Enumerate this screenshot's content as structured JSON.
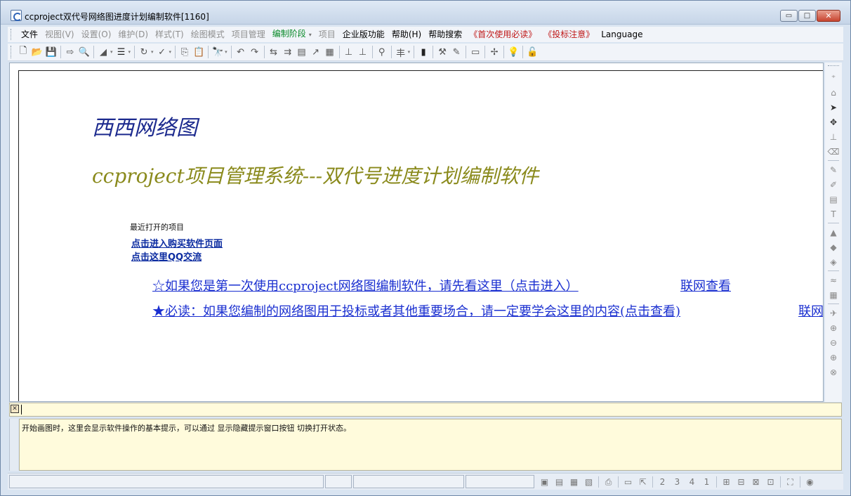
{
  "window": {
    "title": "ccproject双代号网络图进度计划编制软件[1160]",
    "min_label": "▭",
    "max_label": "□",
    "close_label": "✕"
  },
  "menu": {
    "items": [
      {
        "label": "文件",
        "state": "normal"
      },
      {
        "label": "视图(V)",
        "state": "disabled"
      },
      {
        "label": "设置(O)",
        "state": "disabled"
      },
      {
        "label": "维护(D)",
        "state": "disabled"
      },
      {
        "label": "样式(T)",
        "state": "disabled"
      },
      {
        "label": "绘图模式",
        "state": "disabled"
      },
      {
        "label": "项目管理",
        "state": "disabled"
      },
      {
        "label": "编制阶段",
        "state": "green"
      },
      {
        "label": "项目",
        "state": "disabled"
      },
      {
        "label": "企业版功能",
        "state": "normal"
      },
      {
        "label": "帮助(H)",
        "state": "normal"
      },
      {
        "label": "帮助搜索",
        "state": "normal"
      },
      {
        "label": "《首次使用必读》",
        "state": "red"
      },
      {
        "label": "《投标注意》",
        "state": "red"
      },
      {
        "label": "Language",
        "state": "normal"
      }
    ],
    "dropdown_glyph": "▾"
  },
  "toolbar": {
    "icons": [
      {
        "name": "new-file-icon",
        "glyph": "🗋",
        "strong": true
      },
      {
        "name": "open-folder-icon",
        "glyph": "📂",
        "strong": true
      },
      {
        "name": "save-icon",
        "glyph": "💾",
        "strong": false
      },
      {
        "name": "sep"
      },
      {
        "name": "export-icon",
        "glyph": "⇨",
        "strong": false
      },
      {
        "name": "print-preview-icon",
        "glyph": "🔍",
        "strong": false
      },
      {
        "name": "sep"
      },
      {
        "name": "line-style-icon",
        "glyph": "◢",
        "strong": false,
        "dropdown": true
      },
      {
        "name": "indent-icon",
        "glyph": "☰",
        "strong": true,
        "dropdown": true
      },
      {
        "name": "sep"
      },
      {
        "name": "refresh-icon",
        "glyph": "↻",
        "strong": false,
        "dropdown": true
      },
      {
        "name": "check-icon",
        "glyph": "✓",
        "strong": false,
        "dropdown": true
      },
      {
        "name": "sep"
      },
      {
        "name": "copy-icon",
        "glyph": "⎘",
        "strong": false
      },
      {
        "name": "paste-icon",
        "glyph": "📋",
        "strong": false
      },
      {
        "name": "sep"
      },
      {
        "name": "find-icon",
        "glyph": "🔭",
        "strong": true,
        "dropdown": true
      },
      {
        "name": "sep"
      },
      {
        "name": "undo-icon",
        "glyph": "↶",
        "strong": false
      },
      {
        "name": "redo-icon",
        "glyph": "↷",
        "strong": false
      },
      {
        "name": "sep"
      },
      {
        "name": "link-icon",
        "glyph": "⇆",
        "strong": false
      },
      {
        "name": "split-icon",
        "glyph": "⇉",
        "strong": false
      },
      {
        "name": "table-icon",
        "glyph": "▤",
        "strong": false
      },
      {
        "name": "curve-icon",
        "glyph": "↗",
        "strong": false
      },
      {
        "name": "stack-icon",
        "glyph": "▦",
        "strong": false
      },
      {
        "name": "sep"
      },
      {
        "name": "align-a-icon",
        "glyph": "⊥",
        "strong": false
      },
      {
        "name": "align-b-icon",
        "glyph": "⊥",
        "strong": false
      },
      {
        "name": "sep"
      },
      {
        "name": "node-icon",
        "glyph": "⚲",
        "strong": false
      },
      {
        "name": "sep"
      },
      {
        "name": "text-format-icon",
        "glyph": "丰",
        "strong": false,
        "dropdown": true
      },
      {
        "name": "sep"
      },
      {
        "name": "bar-chart-icon",
        "glyph": "▮",
        "strong": true
      },
      {
        "name": "sep"
      },
      {
        "name": "tools-icon",
        "glyph": "⚒",
        "strong": false
      },
      {
        "name": "pen-icon",
        "glyph": "✎",
        "strong": false
      },
      {
        "name": "sep"
      },
      {
        "name": "monitor-icon",
        "glyph": "▭",
        "strong": false
      },
      {
        "name": "sep"
      },
      {
        "name": "pointer-icon",
        "glyph": "✢",
        "strong": false
      },
      {
        "name": "sep"
      },
      {
        "name": "bulb-icon",
        "glyph": "💡",
        "strong": false
      },
      {
        "name": "sep"
      },
      {
        "name": "unlock-icon",
        "glyph": "🔓",
        "strong": true
      }
    ]
  },
  "canvas": {
    "brand_title": "西西网络图",
    "system_title": "ccproject项目管理系统---双代号进度计划编制软件",
    "recent_projects_label": "最近打开的项目",
    "buy_link": "点击进入购买软件页面",
    "qq_link": "点击这里QQ交流",
    "first_use_link": "☆如果您是第一次使用ccproject网络图编制软件，请先看这里（点击进入）",
    "first_use_online": "联网查看",
    "must_read_link": "★必读：如果您编制的网络图用于投标或者其他重要场合，请一定要学会这里的内容(点击查看)",
    "must_read_online": "联网查看"
  },
  "right_tools": {
    "icons": [
      {
        "name": "add-node-icon",
        "glyph": "⁺",
        "strong": false
      },
      {
        "name": "tag-icon",
        "glyph": "⌂",
        "strong": false
      },
      {
        "name": "select-arrow-icon",
        "glyph": "➤",
        "strong": true
      },
      {
        "name": "move-icon",
        "glyph": "✥",
        "strong": true
      },
      {
        "name": "ruler-icon",
        "glyph": "⊥",
        "strong": false
      },
      {
        "name": "eraser-icon",
        "glyph": "⌫",
        "strong": false
      },
      {
        "name": "sep"
      },
      {
        "name": "brush-icon",
        "glyph": "✎",
        "strong": false
      },
      {
        "name": "paint-icon",
        "glyph": "✐",
        "strong": false
      },
      {
        "name": "chart-box-icon",
        "glyph": "▤",
        "strong": false
      },
      {
        "name": "text-box-icon",
        "glyph": "T",
        "strong": false
      },
      {
        "name": "sep"
      },
      {
        "name": "hat-up-icon",
        "glyph": "▲",
        "strong": false
      },
      {
        "name": "hat-down-icon",
        "glyph": "◆",
        "strong": false
      },
      {
        "name": "diamond-icon",
        "glyph": "◈",
        "strong": false
      },
      {
        "name": "sep"
      },
      {
        "name": "wave-icon",
        "glyph": "≈",
        "strong": false
      },
      {
        "name": "grid-icon",
        "glyph": "▦",
        "strong": false
      },
      {
        "name": "sep"
      },
      {
        "name": "fly-icon",
        "glyph": "✈",
        "strong": false
      },
      {
        "name": "zoom-in-icon",
        "glyph": "⊕",
        "strong": false
      },
      {
        "name": "zoom-fit-icon",
        "glyph": "⊖",
        "strong": false
      },
      {
        "name": "zoom-all-icon",
        "glyph": "⊕",
        "strong": false
      },
      {
        "name": "zoom-reset-icon",
        "glyph": "⊗",
        "strong": false
      }
    ]
  },
  "hint": {
    "close_glyph": "✕",
    "text": "开始画图时，这里会显示软件操作的基本提示，可以通过 显示隐藏提示窗口按钮 切换打开状态。"
  },
  "statusbar": {
    "icons": [
      {
        "name": "view-a-icon",
        "glyph": "▣"
      },
      {
        "name": "view-b-icon",
        "glyph": "▤"
      },
      {
        "name": "view-c-icon",
        "glyph": "▦"
      },
      {
        "name": "view-d-icon",
        "glyph": "▧"
      },
      {
        "name": "sep"
      },
      {
        "name": "printer-icon",
        "glyph": "⎙"
      },
      {
        "name": "sep"
      },
      {
        "name": "calendar-icon",
        "glyph": "▭"
      },
      {
        "name": "expand-icon",
        "glyph": "⇱"
      },
      {
        "name": "sep"
      },
      {
        "name": "step-2-icon",
        "glyph": "2"
      },
      {
        "name": "step-3-icon",
        "glyph": "3"
      },
      {
        "name": "step-4-icon",
        "glyph": "4"
      },
      {
        "name": "step-1-icon",
        "glyph": "1"
      },
      {
        "name": "sep"
      },
      {
        "name": "spread-a-icon",
        "glyph": "⊞"
      },
      {
        "name": "spread-b-icon",
        "glyph": "⊟"
      },
      {
        "name": "spread-c-icon",
        "glyph": "⊠"
      },
      {
        "name": "spread-d-icon",
        "glyph": "⊡"
      },
      {
        "name": "sep"
      },
      {
        "name": "fit-screen-icon",
        "glyph": "⛶"
      },
      {
        "name": "sep"
      },
      {
        "name": "settings-circle-icon",
        "glyph": "◉"
      }
    ]
  }
}
